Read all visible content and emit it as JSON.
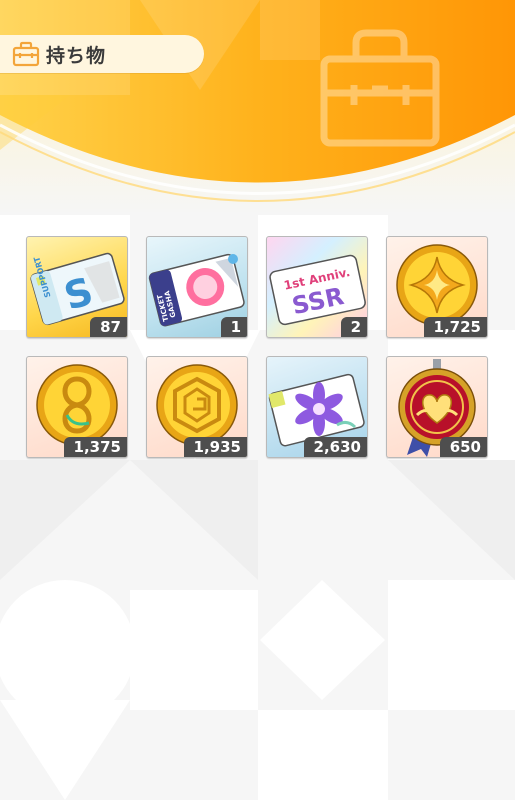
{
  "header": {
    "title": "持ち物",
    "title_icon": "bag-icon",
    "accent": "#ff9a0a"
  },
  "items": [
    {
      "name": "support-ticket",
      "count": "87",
      "icon": "support-s-ticket",
      "art_text": [
        "SUPPORT",
        "S"
      ]
    },
    {
      "name": "gacha-ticket",
      "count": "1",
      "icon": "gacha-ticket",
      "art_text": [
        "GASHA",
        "TICKET"
      ]
    },
    {
      "name": "ssr-ticket",
      "count": "2",
      "icon": "anniv-ssr-ticket",
      "art_text": [
        "1st Anniv.",
        "SSR"
      ]
    },
    {
      "name": "gold-coin-sparkle",
      "count": "1,725",
      "icon": "sparkle-coin"
    },
    {
      "name": "gold-coin-knot",
      "count": "1,375",
      "icon": "knot-coin"
    },
    {
      "name": "gold-coin-hex",
      "count": "1,935",
      "icon": "hex-coin"
    },
    {
      "name": "flower-ticket",
      "count": "2,630",
      "icon": "flower-ticket"
    },
    {
      "name": "heart-medal",
      "count": "650",
      "icon": "heart-medal"
    }
  ]
}
